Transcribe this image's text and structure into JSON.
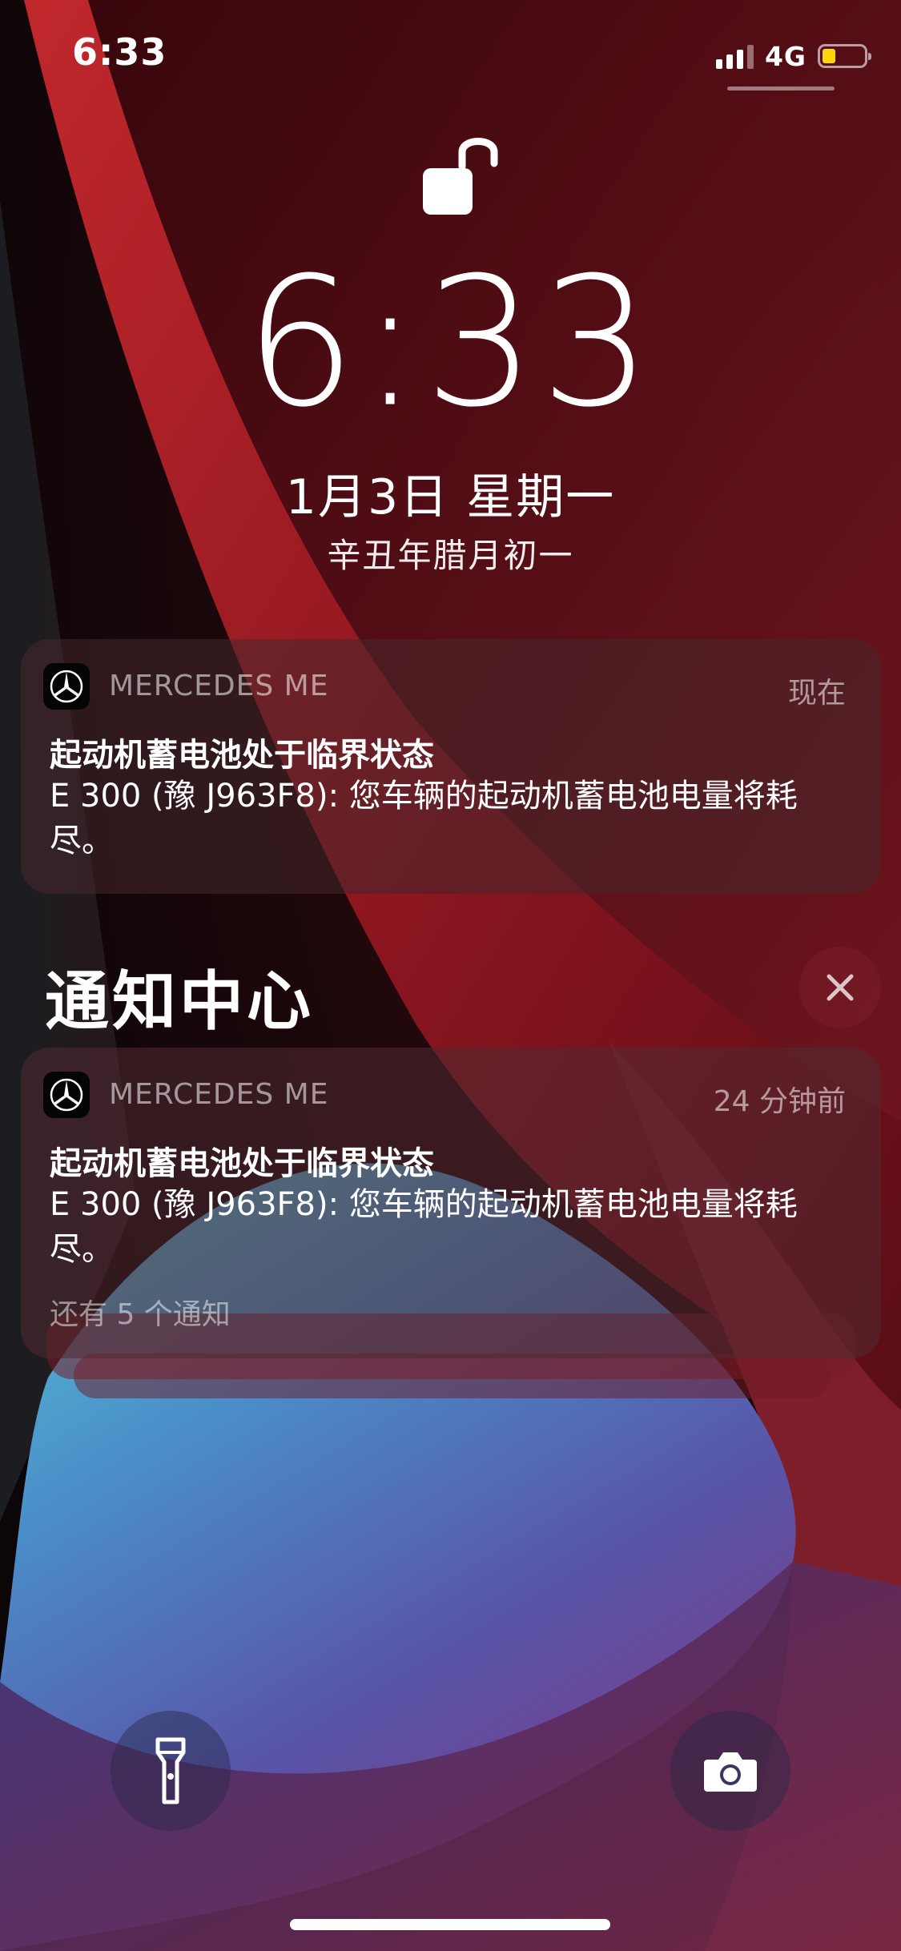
{
  "status_bar": {
    "time": "6:33",
    "network": "4G",
    "signal_bars_filled": 3,
    "battery_level": "low"
  },
  "lock_screen": {
    "time": "6:33",
    "date": "1月3日 星期一",
    "lunar_date": "辛丑年腊月初一"
  },
  "top_notification": {
    "app_name": "MERCEDES ME",
    "time": "现在",
    "title": "起动机蓄电池处于临界状态",
    "body": "E 300 (豫 J963F8): 您车辆的起动机蓄电池电量将耗尽。"
  },
  "notification_center": {
    "title": "通知中心",
    "close_icon": "close-icon"
  },
  "stacked_notification": {
    "app_name": "MERCEDES ME",
    "time": "24 分钟前",
    "title": "起动机蓄电池处于临界状态",
    "body": "E 300 (豫 J963F8): 您车辆的起动机蓄电池电量将耗尽。",
    "more": "还有 5 个通知"
  },
  "quick_actions": {
    "left_icon": "flashlight-icon",
    "right_icon": "camera-icon"
  },
  "colors": {
    "battery_fill": "#ffd60a",
    "card_bg": "#46282c"
  }
}
